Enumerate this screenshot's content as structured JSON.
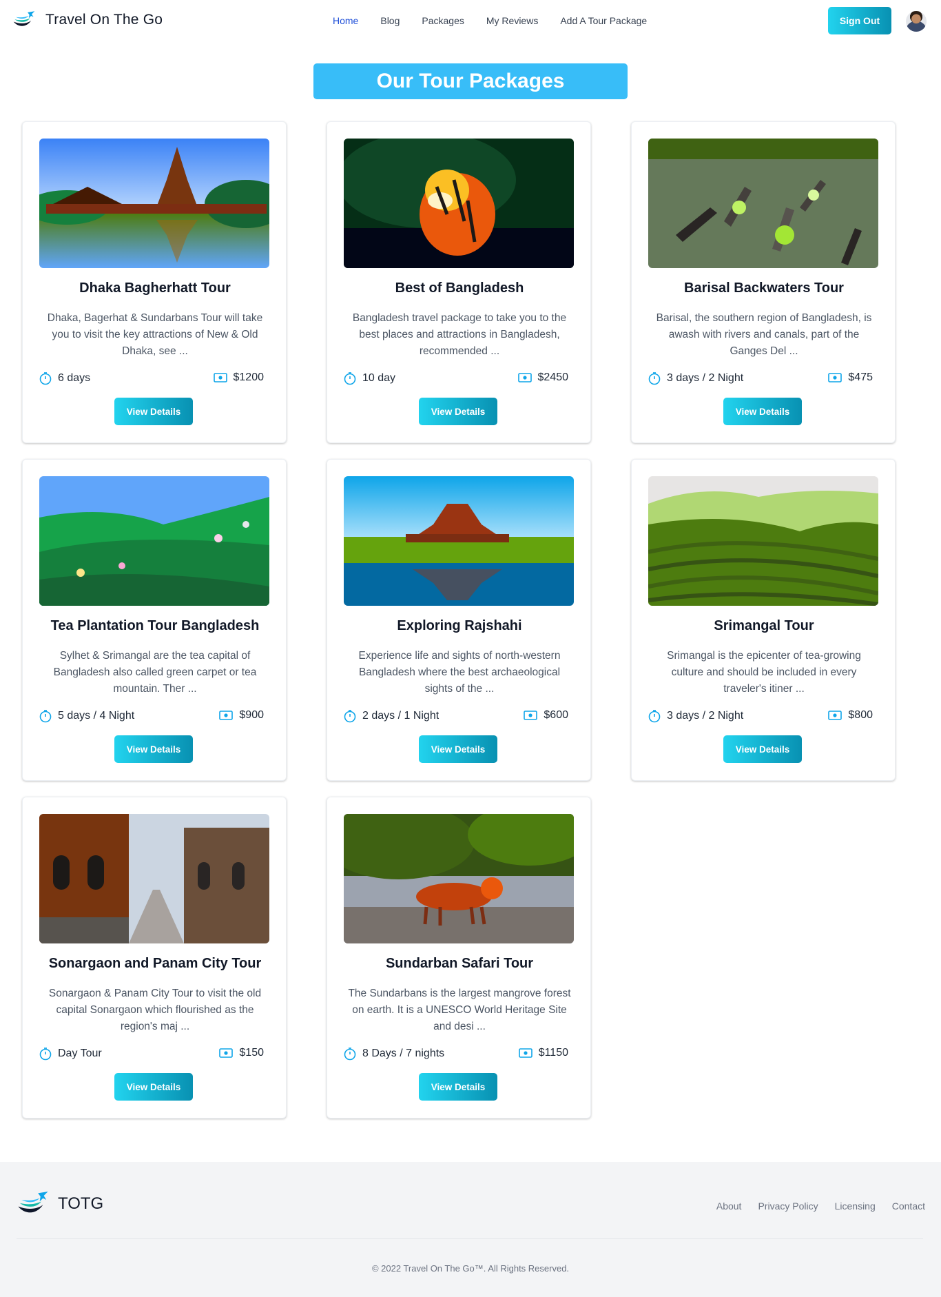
{
  "header": {
    "brand": "Travel On The Go",
    "nav": [
      "Home",
      "Blog",
      "Packages",
      "My Reviews",
      "Add A Tour Package"
    ],
    "active_nav": "Home",
    "signout_label": "Sign Out",
    "accent_color": "#38bdf8"
  },
  "main": {
    "title": "Our Tour Packages",
    "view_details_label": "View Details",
    "packages": [
      {
        "title": "Dhaka Bagherhatt Tour",
        "description": "Dhaka, Bagerhat & Sundarbans Tour will take you to visit the key attractions of New & Old Dhaka, see ...",
        "duration": "6 days",
        "price": "$1200",
        "image": "temple reflected in a lake"
      },
      {
        "title": "Best of Bangladesh",
        "description": "Bangladesh travel package to take you to the best places and attractions in Bangladesh, recommended ...",
        "duration": "10 day",
        "price": "$2450",
        "image": "tiger in dark water"
      },
      {
        "title": "Barisal Backwaters Tour",
        "description": "Barisal, the southern region of Bangladesh, is awash with rivers and canals, part of the Ganges Del ...",
        "duration": "3 days / 2 Night",
        "price": "$475",
        "image": "floating market boats"
      },
      {
        "title": "Tea Plantation Tour Bangladesh",
        "description": "Sylhet & Srimangal are the tea capital of Bangladesh also called green carpet or tea mountain. Ther ...",
        "duration": "5 days / 4 Night",
        "price": "$900",
        "image": "tea pickers on green slope"
      },
      {
        "title": "Exploring Rajshahi",
        "description": "Experience life and sights of north-western Bangladesh where the best archaeological sights of the ...",
        "duration": "2 days / 1 Night",
        "price": "$600",
        "image": "ancient brick temple by water"
      },
      {
        "title": "Srimangal Tour",
        "description": "Srimangal is the epicenter of tea-growing culture and should be included in every traveler's itiner ...",
        "duration": "3 days / 2 Night",
        "price": "$800",
        "image": "terraced green hills"
      },
      {
        "title": "Sonargaon and Panam City Tour",
        "description": "Sonargaon & Panam City Tour to visit the old capital Sonargaon which flourished as the region's maj ...",
        "duration": "Day Tour",
        "price": "$150",
        "image": "old brick buildings street"
      },
      {
        "title": "Sundarban Safari Tour",
        "description": "The Sundarbans is the largest mangrove forest on earth. It is a UNESCO World Heritage Site and desi ...",
        "duration": "8 Days / 7 nights",
        "price": "$1150",
        "image": "tiger in mangrove"
      }
    ]
  },
  "footer": {
    "brand": "TOTG",
    "links": [
      "About",
      "Privacy Policy",
      "Licensing",
      "Contact"
    ],
    "copyright": "© 2022 Travel On The Go™. All Rights Reserved."
  },
  "icons": {
    "logo": "airplane-logo-icon",
    "duration": "stopwatch-icon",
    "price": "banknote-icon"
  }
}
